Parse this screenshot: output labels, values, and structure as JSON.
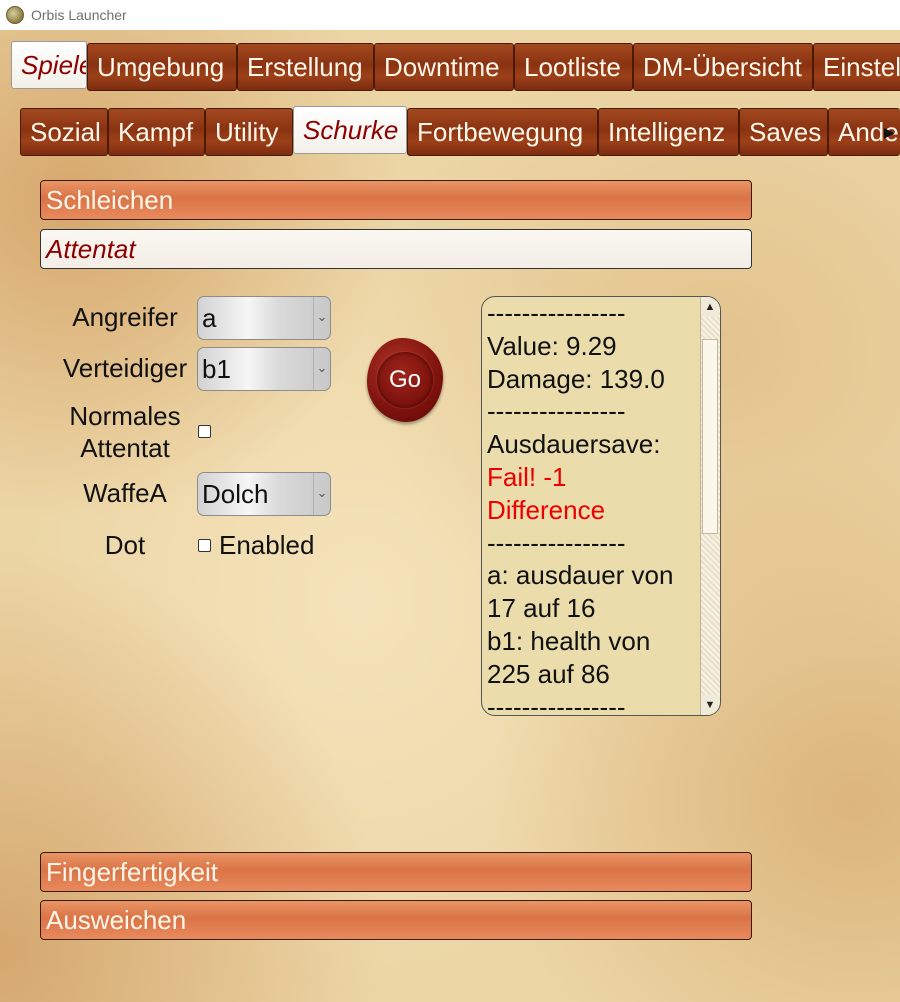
{
  "window": {
    "title": "Orbis Launcher",
    "icon": "app-icon"
  },
  "main_tabs": [
    "Spieler",
    "Umgebung",
    "Erstellung",
    "Downtime",
    "Lootliste",
    "DM-Übersicht",
    "Einstellungen"
  ],
  "main_tabs_active": "Spieler",
  "sub_tabs": [
    "Sozial",
    "Kampf",
    "Utility",
    "Schurke",
    "Fortbewegung",
    "Intelligenz",
    "Saves",
    "Andere"
  ],
  "sub_tabs_active": "Schurke",
  "sub_tabs_scroll_icon": "chevron-right-icon",
  "sections": {
    "schleichen": "Schleichen",
    "attentat": "Attentat",
    "fingerfertigkeit": "Fingerfertigkeit",
    "ausweichen": "Ausweichen"
  },
  "form": {
    "angreifer_label": "Angreifer",
    "angreifer_value": "a",
    "verteidiger_label": "Verteidiger",
    "verteidiger_value": "b1",
    "normales_label_1": "Normales",
    "normales_label_2": "Attentat",
    "normales_checked": false,
    "waffe_label": "WaffeA",
    "waffe_value": "Dolch",
    "dot_label": "Dot",
    "dot_checkbox_label": "Enabled",
    "dot_checked": false
  },
  "go_button": "Go",
  "output": {
    "lines": [
      "----------------",
      "Value: 9.29",
      "Damage: 139.0",
      "----------------",
      "Ausdauersave:",
      "Fail! -1",
      "Difference",
      "----------------",
      "a: ausdauer von",
      "17 auf 16",
      "b1: health von",
      "225 auf 86",
      "----------------"
    ],
    "error_color": "#ee0000"
  },
  "colors": {
    "tab_brown": "#8a3312",
    "active_text": "#8b0000",
    "expander_orange": "#da7447",
    "parchment": "#ecd6a6",
    "wax_seal": "#7d120d"
  }
}
